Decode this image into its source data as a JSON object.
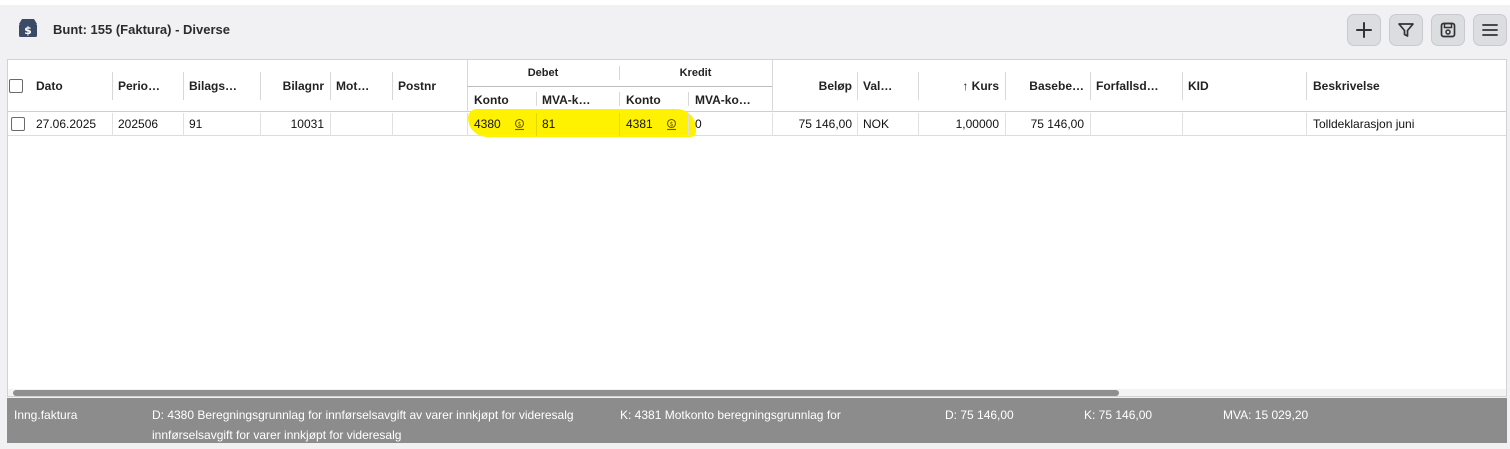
{
  "header": {
    "title": "Bunt: 155 (Faktura) - Diverse"
  },
  "toolbar": {
    "add_icon": "plus-icon",
    "filter_icon": "filter-icon",
    "save_icon": "save-icon",
    "menu_icon": "hamburger-menu-icon"
  },
  "table": {
    "groups": {
      "debet": "Debet",
      "kredit": "Kredit"
    },
    "columns": {
      "dato": "Dato",
      "periode": "Perio…",
      "bilagsart": "Bilags…",
      "bilagnr": "Bilagnr",
      "motpart": "Mot…",
      "postnr": "Postnr",
      "debet_konto": "Konto",
      "debet_mva": "MVA-k…",
      "kredit_konto": "Konto",
      "kredit_mva": "MVA-ko…",
      "belop": "Beløp",
      "valuta": "Val…",
      "kurs": "↑ Kurs",
      "basebelop": "Basebe…",
      "forfallsdato": "Forfallsd…",
      "kid": "KID",
      "beskrivelse": "Beskrivelse"
    },
    "rows": [
      {
        "dato": "27.06.2025",
        "periode": "202506",
        "bilagsart": "91",
        "bilagnr": "10031",
        "motpart": "",
        "postnr": "",
        "debet_konto": "4380",
        "debet_mva": "81",
        "kredit_konto": "4381",
        "kredit_mva": "0",
        "belop": "75 146,00",
        "valuta": "NOK",
        "kurs": "1,00000",
        "basebelop": "75 146,00",
        "forfallsdato": "",
        "kid": "",
        "beskrivelse": "Tolldeklarasjon juni"
      }
    ]
  },
  "footer": {
    "type": "Inng.faktura",
    "debet_line1": "D: 4380 Beregningsgrunnlag for innførselsavgift av varer innkjøpt for videresalg",
    "kredit_line1": "K: 4381 Motkonto beregningsgrunnlag for",
    "line2": "innførselsavgift for varer innkjøpt for videresalg",
    "debet_sum": "D: 75 146,00",
    "kredit_sum": "K: 75 146,00",
    "mva_sum": "MVA: 15 029,20"
  },
  "colors": {
    "highlight": "#fff200",
    "footer_bg": "#8c8c8c",
    "toolbar_button": "#dcdde1"
  }
}
